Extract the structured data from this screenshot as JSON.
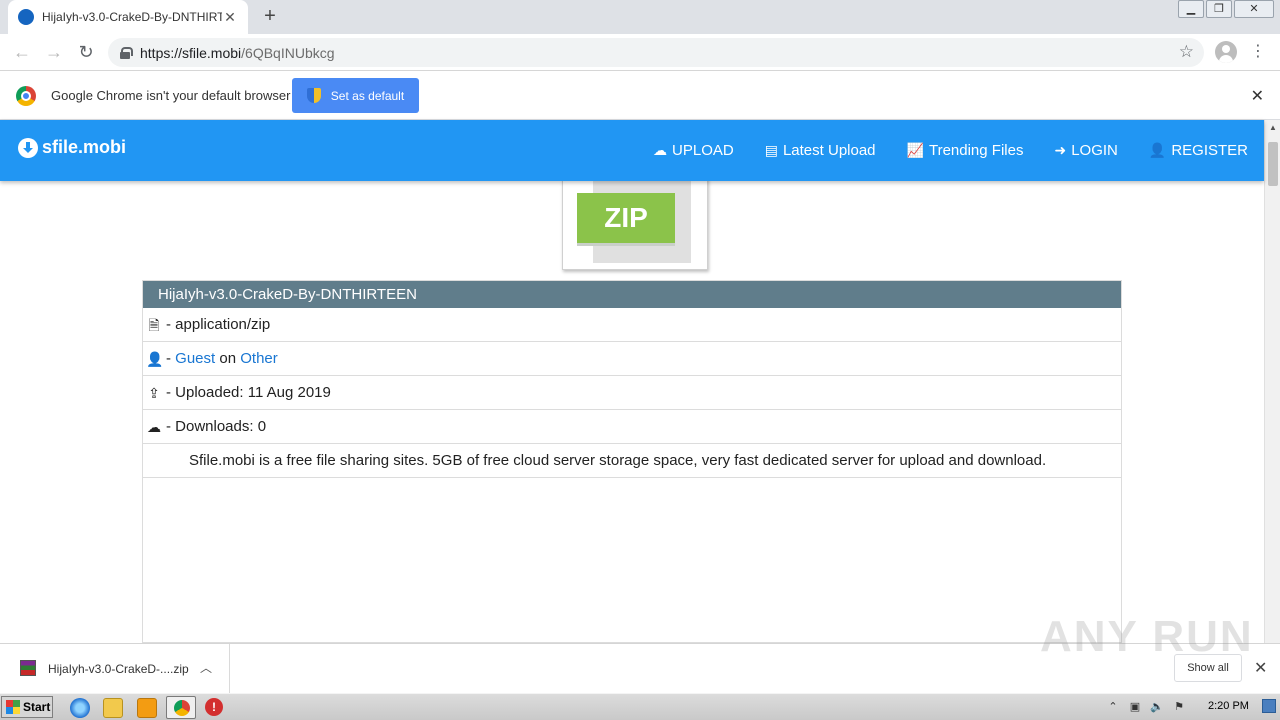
{
  "browser": {
    "tab_title": "HijaIyh-v3.0-CrakeD-By-DNTHIRTEEN",
    "url_host": "https://sfile.mobi",
    "url_path": "/6QBqINUbkcg"
  },
  "infobar": {
    "message": "Google Chrome isn't your default browser",
    "button_label": "Set as default"
  },
  "site": {
    "brand": "sfile.mobi",
    "nav": [
      {
        "icon": "cloud-upload-icon",
        "label": "UPLOAD"
      },
      {
        "icon": "list-icon",
        "label": "Latest Upload"
      },
      {
        "icon": "trend-icon",
        "label": "Trending Files"
      },
      {
        "icon": "login-icon",
        "label": "LOGIN"
      },
      {
        "icon": "user-plus-icon",
        "label": "REGISTER"
      }
    ]
  },
  "file": {
    "badge": "ZIP",
    "name": "HijaIyh-v3.0-CrakeD-By-DNTHIRTEEN",
    "mime": "- application/zip",
    "uploader_prefix": "- ",
    "uploader": "Guest",
    "on_text": " on ",
    "category": "Other",
    "uploaded": "- Uploaded: 11 Aug 2019",
    "downloads": "- Downloads: 0",
    "description": "Sfile.mobi is a free file sharing sites. 5GB of free cloud server storage space, very fast dedicated server for upload and download."
  },
  "download_shelf": {
    "item_name": "HijaIyh-v3.0-CrakeD-....zip",
    "show_all": "Show all"
  },
  "watermark": "ANY RUN",
  "taskbar": {
    "start": "Start",
    "clock": "2:20 PM"
  },
  "colors": {
    "navbar": "#2196f3",
    "file_header": "#607d8b",
    "zip_badge": "#8bc34a",
    "link": "#1976d2"
  }
}
